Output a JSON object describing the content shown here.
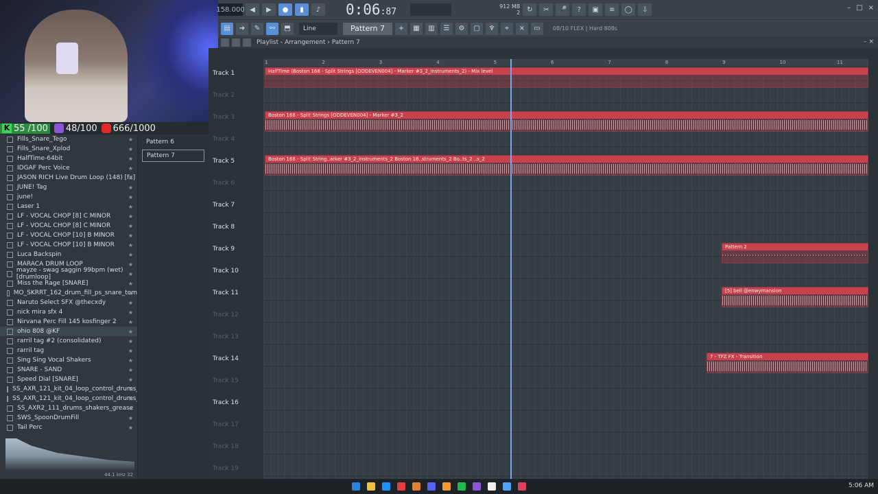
{
  "stats": {
    "k_count": "55 /100",
    "k_label": "K",
    "pill_count": "48/100",
    "yt_count": "666/1000"
  },
  "toolbar": {
    "tempo": "158.000",
    "time_main": "0:06",
    "time_small": ":87",
    "mem_top": "912 MB",
    "mem_bot": "2"
  },
  "toolbar2": {
    "line": "Line",
    "pattern": "Pattern 7",
    "snap_info": "08/10  FLEX | Hard 808s"
  },
  "playlist": {
    "title": "Playlist - Arrangement",
    "pattern": "Pattern 7"
  },
  "browser": {
    "items": [
      "Fills_Snare_Tego",
      "Fills_Snare_Xplod",
      "HalfTime-64bit",
      "IDGAF Perc Voice",
      "JASON RICH Live Drum Loop (148) [fx]",
      "JUNE! Tag",
      "june!",
      "Laser 1",
      "LF - VOCAL CHOP [8] C MINOR",
      "LF - VOCAL CHOP [8] C MINOR",
      "LF - VOCAL CHOP [10] B MINOR",
      "LF - VOCAL CHOP [10] B MINOR",
      "Luca Backspin",
      "MARACA DRUM LOOP",
      "mayze - swag saggin 99bpm (wet) [drumloop]",
      "Miss the Rage [SNARE]",
      "MO_SKRRT_162_drum_fill_ps_snare_tom",
      "Naruto Select SFX @thecxdy",
      "nick mira sfx 4",
      "Nirvana Perc Fill 145 kosfinger 2",
      "ohio 808 @KF",
      "rarril tag #2 (consolidated)",
      "rarril tag",
      "Sing Sing Vocal Shakers",
      "SNARE - SAND",
      "Speed Dial [SNARE]",
      "SS_AXR_121_kit_04_loop_control_drums_full",
      "SS_AXR_121_kit_04_loop_control_drums_top",
      "SS_AXR2_111_drums_shakers_grease",
      "SWS_SpoonDrumFill",
      "Tail Perc"
    ],
    "rate": "44.1 kHz 32"
  },
  "patterns": [
    "Pattern 6",
    "Pattern 7"
  ],
  "tracks": [
    {
      "label": "Track 1",
      "dim": false
    },
    {
      "label": "Track 2",
      "dim": true
    },
    {
      "label": "Track 3",
      "dim": true
    },
    {
      "label": "Track 4",
      "dim": true
    },
    {
      "label": "Track 5",
      "dim": false
    },
    {
      "label": "Track 6",
      "dim": true
    },
    {
      "label": "Track 7",
      "dim": false
    },
    {
      "label": "Track 8",
      "dim": false
    },
    {
      "label": "Track 9",
      "dim": false
    },
    {
      "label": "Track 10",
      "dim": false
    },
    {
      "label": "Track 11",
      "dim": false
    },
    {
      "label": "Track 12",
      "dim": true
    },
    {
      "label": "Track 13",
      "dim": true
    },
    {
      "label": "Track 14",
      "dim": false
    },
    {
      "label": "Track 15",
      "dim": true
    },
    {
      "label": "Track 16",
      "dim": false
    },
    {
      "label": "Track 17",
      "dim": true
    },
    {
      "label": "Track 18",
      "dim": true
    },
    {
      "label": "Track 19",
      "dim": true
    }
  ],
  "ruler": [
    "1",
    "2",
    "3",
    "4",
    "5",
    "6",
    "7",
    "8",
    "9",
    "10",
    "11"
  ],
  "clips": {
    "c1": "HalfTime (Boston 168 - Split Strings [ODDEVEN004] - Marker #3_2_instruments_2) - Mix level",
    "c3": "Boston 168 - Split Strings [ODDEVEN004] - Marker #3_2",
    "c5": "Boston 168 - Split String..arker #3_2_instruments_2  Boston 16..struments_2  Bo..ts_2  ..s_2",
    "c9": "Pattern 2",
    "c11": "[5] bell @enwymansion",
    "c14": "7 - TFZ FX - Transition"
  },
  "taskbar": {
    "time": "5:06 AM"
  }
}
